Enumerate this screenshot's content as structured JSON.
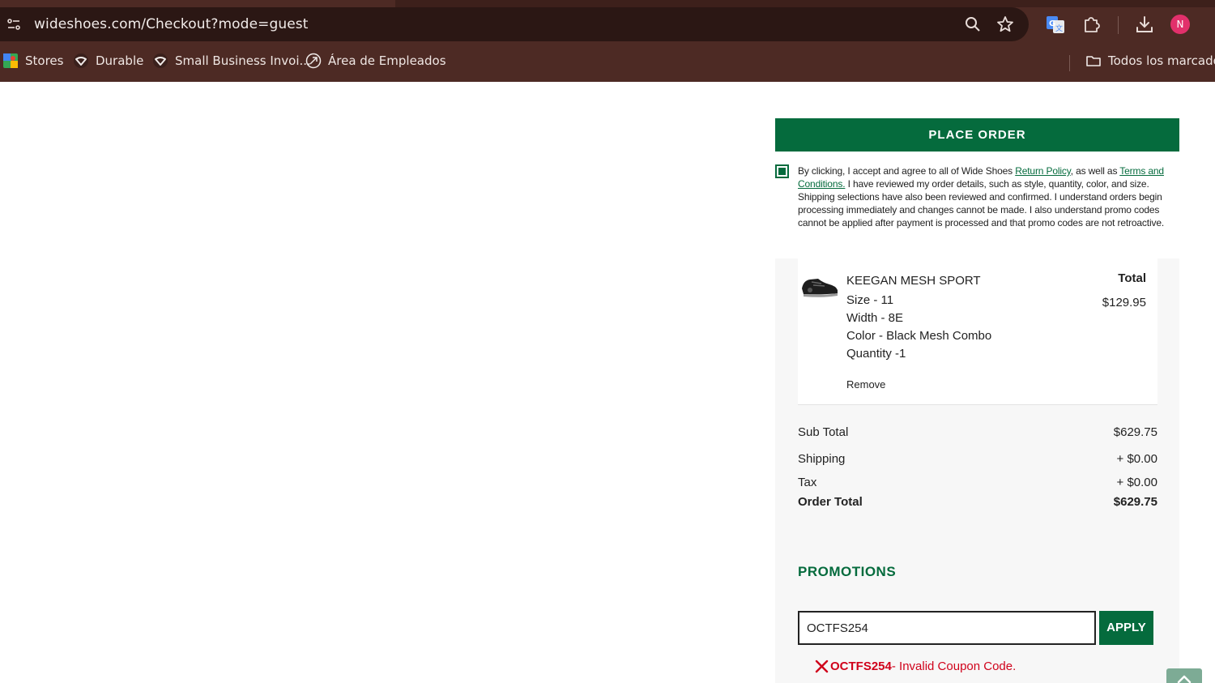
{
  "browser": {
    "url": "wideshoes.com/Checkout?mode=guest",
    "profile_initial": "N",
    "bookmarks": [
      {
        "label": "Stores",
        "icon": "maps-icon"
      },
      {
        "label": "Durable",
        "icon": "durable-icon"
      },
      {
        "label": "Small Business Invoi...",
        "icon": "durable-icon"
      },
      {
        "label": "Área de Empleados",
        "icon": "compass-icon"
      }
    ],
    "all_bookmarks_label": "Todos los marcadores"
  },
  "checkout": {
    "place_order_label": "PLACE ORDER",
    "agree_checked": true,
    "agree_text_1": "By clicking, I accept and agree to all of Wide Shoes ",
    "return_policy_link": "Return Policy",
    "agree_text_2": ", as well as ",
    "terms_link": "Terms and Conditions.",
    "agree_text_3": " I have reviewed my order details, such as style, quantity, color, and size. Shipping selections have also been reviewed and confirmed. I understand orders begin processing immediately and changes cannot be made. I also understand promo codes cannot be applied after payment is processed and that promo codes are not retroactive."
  },
  "item": {
    "name": "KEEGAN MESH SPORT",
    "size": "Size - 11",
    "width": "Width - 8E",
    "color": "Color - Black Mesh Combo",
    "quantity": "Quantity -1",
    "total_label": "Total",
    "total_value": "$129.95",
    "remove_label": "Remove"
  },
  "totals": {
    "subtotal_label": "Sub Total",
    "subtotal_value": "$629.75",
    "shipping_label": "Shipping",
    "shipping_value": "+ $0.00",
    "tax_label": "Tax",
    "tax_value": "+ $0.00",
    "order_total_label": "Order Total",
    "order_total_value": "$629.75"
  },
  "promotions": {
    "title": "PROMOTIONS",
    "code_value": "OCTFS254",
    "apply_label": "APPLY",
    "error_code": "OCTFS254",
    "error_message": " - Invalid Coupon Code."
  },
  "colors": {
    "brand_green": "#056b3d",
    "error_red": "#d0021b",
    "chrome_brown": "#4d2a24"
  }
}
